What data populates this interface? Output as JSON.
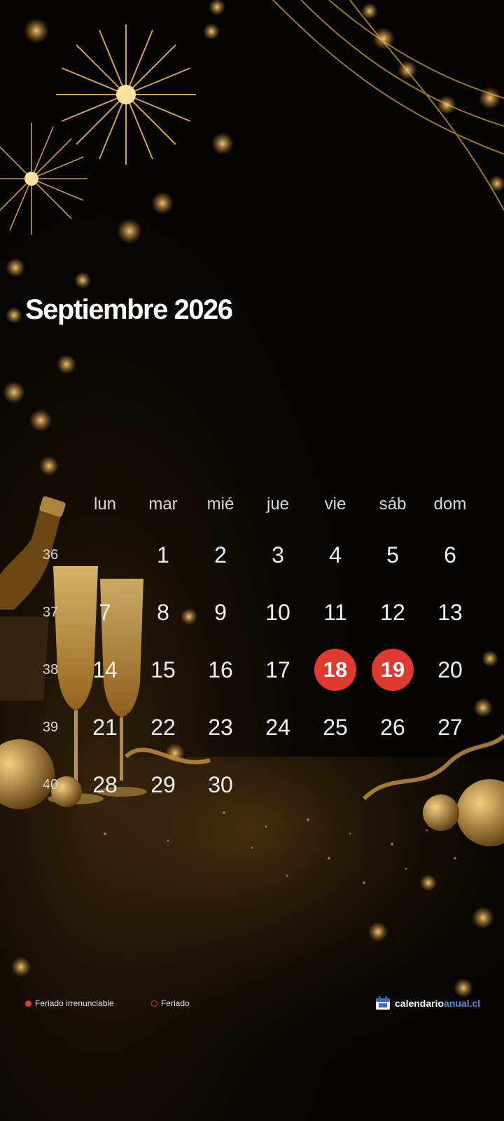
{
  "calendar": {
    "title": "Septiembre 2026",
    "weekdays": [
      "lun",
      "mar",
      "mié",
      "jue",
      "vie",
      "sáb",
      "dom"
    ],
    "weeks": [
      {
        "number": "36",
        "days": [
          "",
          "1",
          "2",
          "3",
          "4",
          "5",
          "6"
        ]
      },
      {
        "number": "37",
        "days": [
          "7",
          "8",
          "9",
          "10",
          "11",
          "12",
          "13"
        ]
      },
      {
        "number": "38",
        "days": [
          "14",
          "15",
          "16",
          "17",
          "18",
          "19",
          "20"
        ]
      },
      {
        "number": "39",
        "days": [
          "21",
          "22",
          "23",
          "24",
          "25",
          "26",
          "27"
        ]
      },
      {
        "number": "40",
        "days": [
          "28",
          "29",
          "30",
          "",
          "",
          "",
          ""
        ]
      }
    ],
    "holidays_irrenunciable": [
      "18",
      "19"
    ],
    "holidays_regular": []
  },
  "legend": {
    "irrenunciable_label": "Feriado irrenunciable",
    "feriado_label": "Feriado"
  },
  "brand": {
    "name_part1": "calendario",
    "name_part2": "anual.cl"
  },
  "colors": {
    "holiday": "#e03a30",
    "brand_accent": "#5a8de0",
    "gold": "#d9a54a"
  }
}
